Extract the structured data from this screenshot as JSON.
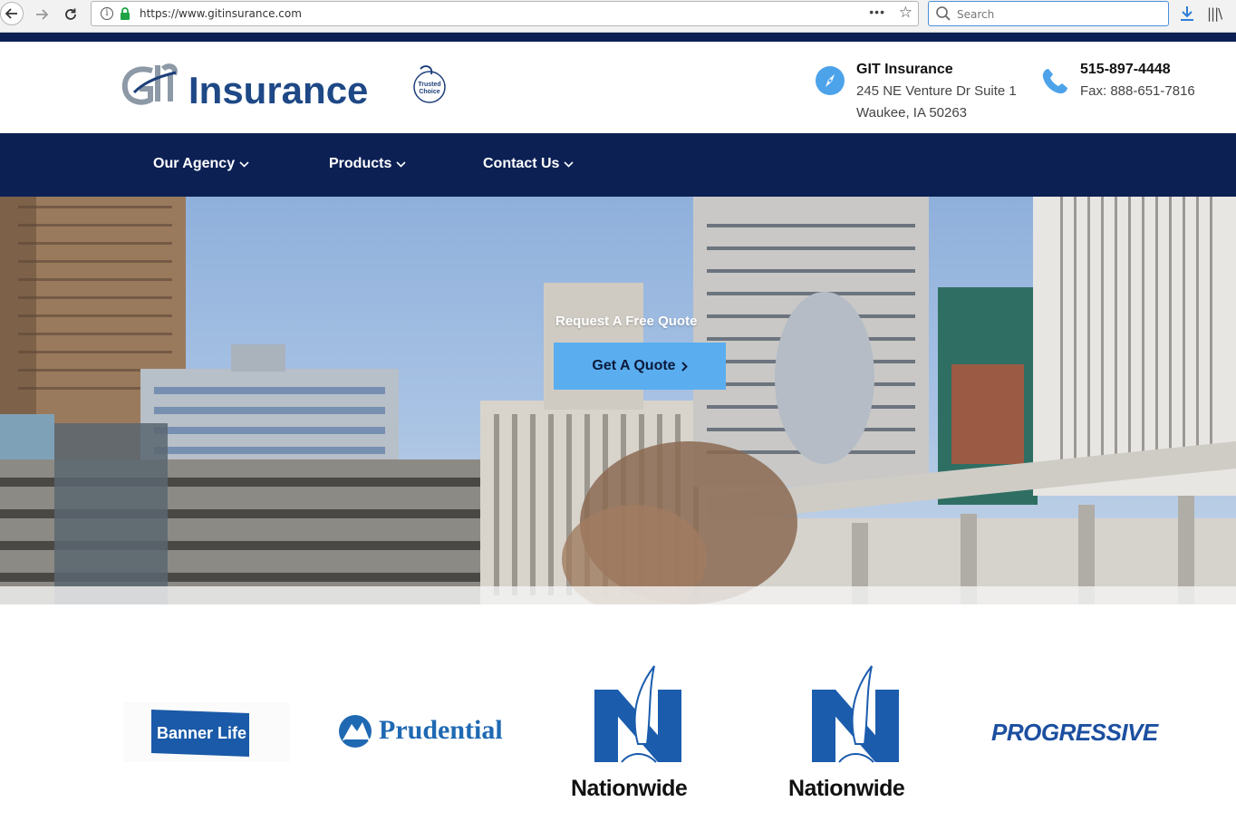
{
  "browser": {
    "url": "https://www.gitinsurance.com",
    "search_placeholder": "Search"
  },
  "header": {
    "logo_text": "Insurance",
    "badge_text": "Trusted Choice",
    "address": {
      "name": "GIT Insurance",
      "line1": "245 NE Venture Dr Suite 1",
      "line2": "Waukee, IA 50263"
    },
    "phone": {
      "main": "515-897-4448",
      "fax": "Fax: 888-651-7816"
    }
  },
  "nav": {
    "items": [
      {
        "label": "Our Agency"
      },
      {
        "label": "Products"
      },
      {
        "label": "Contact Us"
      }
    ]
  },
  "hero": {
    "caption": "Request A Free Quote",
    "button_label": "Get A Quote"
  },
  "carriers": {
    "banner_life": "Banner Life",
    "prudential": "Prudential",
    "nationwide": "Nationwide",
    "progressive": "PROGRESSIVE"
  },
  "colors": {
    "navy": "#0c2054",
    "accent_blue": "#5aaef0",
    "icon_blue": "#4da3ea"
  }
}
